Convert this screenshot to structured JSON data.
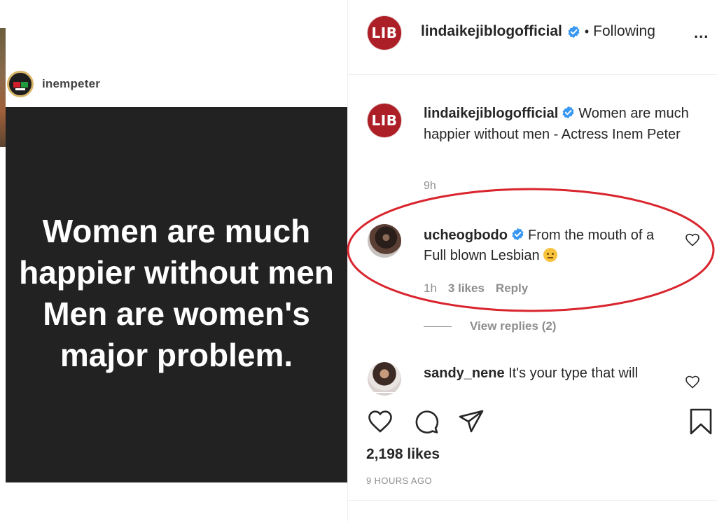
{
  "post": {
    "repost_username": "inempeter",
    "image_lines": [
      "Women are much",
      "happier without men",
      "Men are women's",
      "major problem."
    ]
  },
  "header": {
    "logo_text": "LIB",
    "username": "lindaikejiblogofficial",
    "separator": "•",
    "follow_status": "Following",
    "more_label": "..."
  },
  "caption": {
    "logo_text": "LIB",
    "username": "lindaikejiblogofficial",
    "text": "Women are much happier without men - Actress Inem Peter",
    "time": "9h"
  },
  "comments": [
    {
      "username": "ucheogbodo",
      "text": "From the mouth of a Full blown Lesbian",
      "time": "1h",
      "likes": "3 likes",
      "reply_label": "Reply",
      "view_replies": "View replies (2)"
    },
    {
      "username": "sandy_nene",
      "text": "It's your type that will"
    }
  ],
  "footer": {
    "likes": "2,198 likes",
    "age": "9 HOURS AGO"
  },
  "colors": {
    "lib_red": "#ad1f26",
    "verified_blue": "#3897f0",
    "annotation_red": "#d9252e",
    "image_bg": "#222222"
  }
}
